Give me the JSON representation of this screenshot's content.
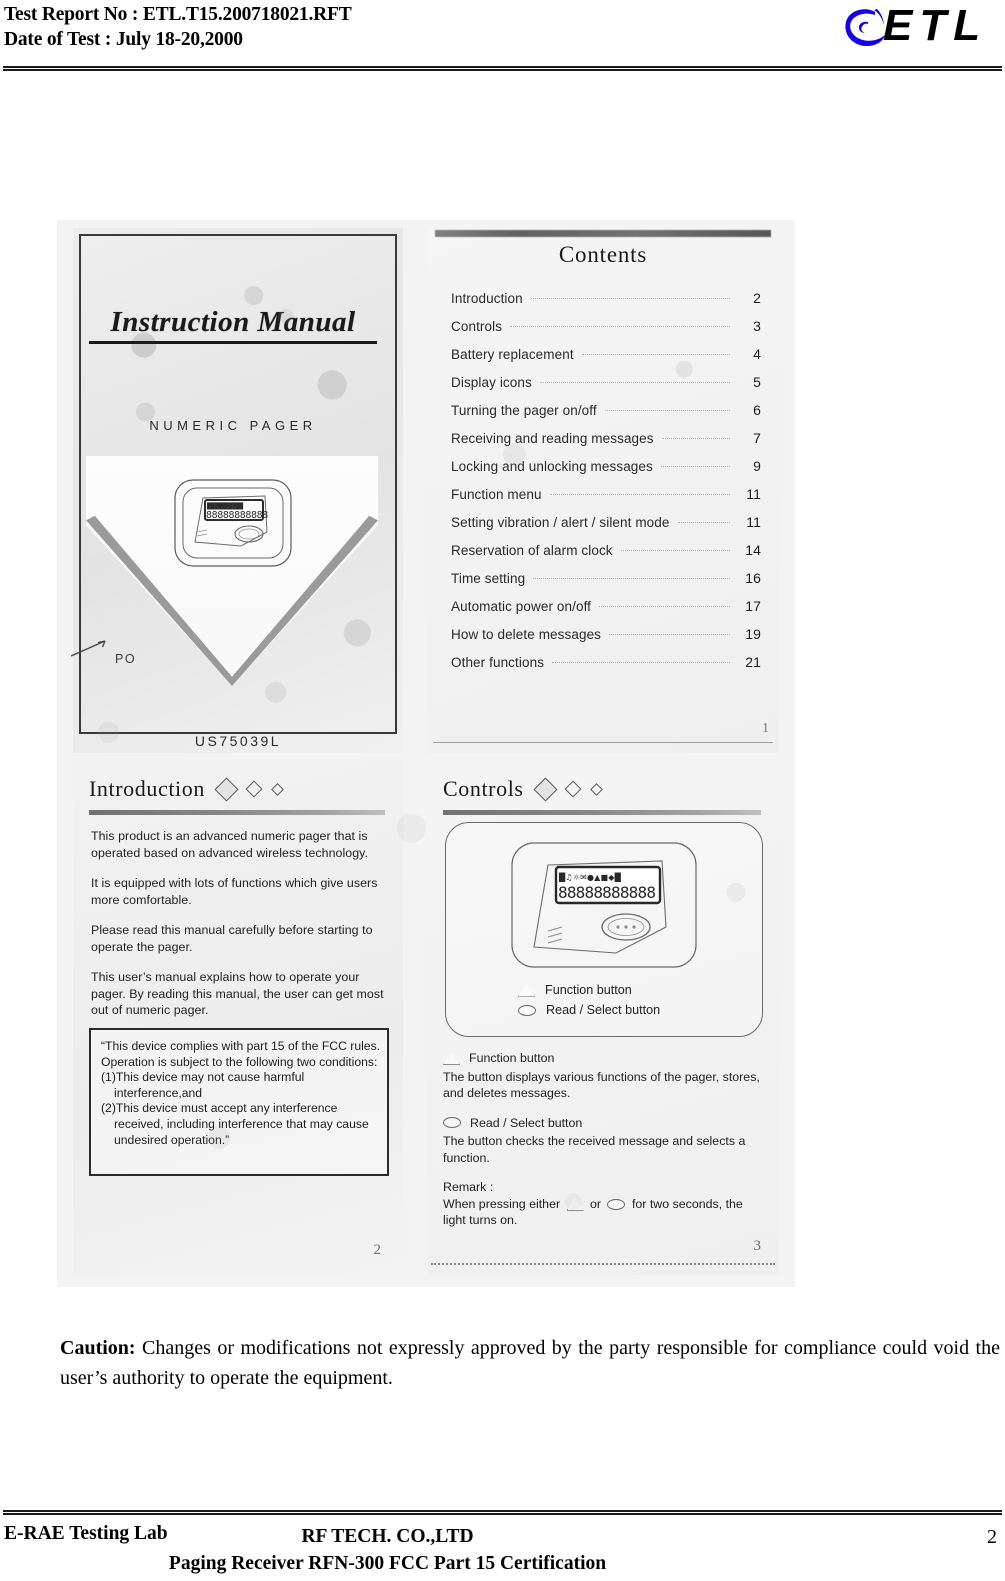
{
  "header": {
    "report_no_line": "Test Report No : ETL.T15.200718021.RFT",
    "date_line": "Date of Test : July 18-20,2000",
    "logo_text": "ETL",
    "logo_mark_name": "etl-swirl-logo",
    "logo_color": "#1500e8"
  },
  "scan": {
    "cover": {
      "title": "Instruction Manual",
      "subtitle": "NUMERIC PAGER",
      "po_label": "PO",
      "model_code": "US75039L",
      "lcd_digits": "88888888888"
    },
    "contents": {
      "title": "Contents",
      "page_number": "1",
      "entries": [
        {
          "label": "Introduction",
          "page": "2"
        },
        {
          "label": "Controls",
          "page": "3"
        },
        {
          "label": "Battery replacement",
          "page": "4"
        },
        {
          "label": "Display icons",
          "page": "5"
        },
        {
          "label": "Turning the pager on/off",
          "page": "6"
        },
        {
          "label": "Receiving and reading messages",
          "page": "7"
        },
        {
          "label": "Locking and unlocking messages",
          "page": "9"
        },
        {
          "label": "Function menu",
          "page": "11"
        },
        {
          "label": "Setting vibration / alert / silent mode",
          "page": "11"
        },
        {
          "label": "Reservation of alarm clock",
          "page": "14"
        },
        {
          "label": "Time setting",
          "page": "16"
        },
        {
          "label": "Automatic power on/off",
          "page": "17"
        },
        {
          "label": "How to delete messages",
          "page": "19"
        },
        {
          "label": "Other functions",
          "page": "21"
        }
      ]
    },
    "introduction": {
      "title": "Introduction",
      "page_number": "2",
      "paragraphs": [
        "This product is an advanced numeric pager that is operated based on advanced wireless technology.",
        "It is equipped with lots of functions which give users more comfortable.",
        "Please read this manual carefully before starting to operate the pager.",
        "This user’s manual explains how to operate your pager. By reading this manual, the user can get most out of numeric pager."
      ],
      "fcc_box": {
        "line1": "“This device complies with part 15 of the FCC rules. Operation is subject to the following two conditions:",
        "line2": "(1)This device may not cause harmful",
        "line2_indent": "interference,and",
        "line3": "(2)This device must accept any interference",
        "line3_indent": "received, including interference that may cause undesired operation.”"
      }
    },
    "controls": {
      "title": "Controls",
      "page_number": "3",
      "lcd_digits": "88888888888",
      "legend": [
        {
          "icon": "triangle-button-icon",
          "label": "Function button"
        },
        {
          "icon": "oval-button-icon",
          "label": "Read / Select button"
        }
      ],
      "descriptions": [
        {
          "icon": "triangle-button-icon",
          "heading": "Function button",
          "text": "The button displays various functions of the pager, stores, and deletes messages."
        },
        {
          "icon": "oval-button-icon",
          "heading": "Read / Select button",
          "text": "The button checks the received message and selects a function."
        }
      ],
      "remark": {
        "heading": "Remark :",
        "text_before": "When pressing either",
        "text_middle": "or",
        "text_after": "for two seconds, the light turns on."
      }
    }
  },
  "caution": {
    "label": "Caution:",
    "text": " Changes or modifications not expressly approved by the party responsible for compliance could void the user’s authority to operate the equipment."
  },
  "footer": {
    "lab": "E-RAE Testing Lab",
    "company": "RF TECH. CO.,LTD",
    "subject": "Paging Receiver RFN-300 FCC Part 15 Certification",
    "page_number": "2"
  }
}
